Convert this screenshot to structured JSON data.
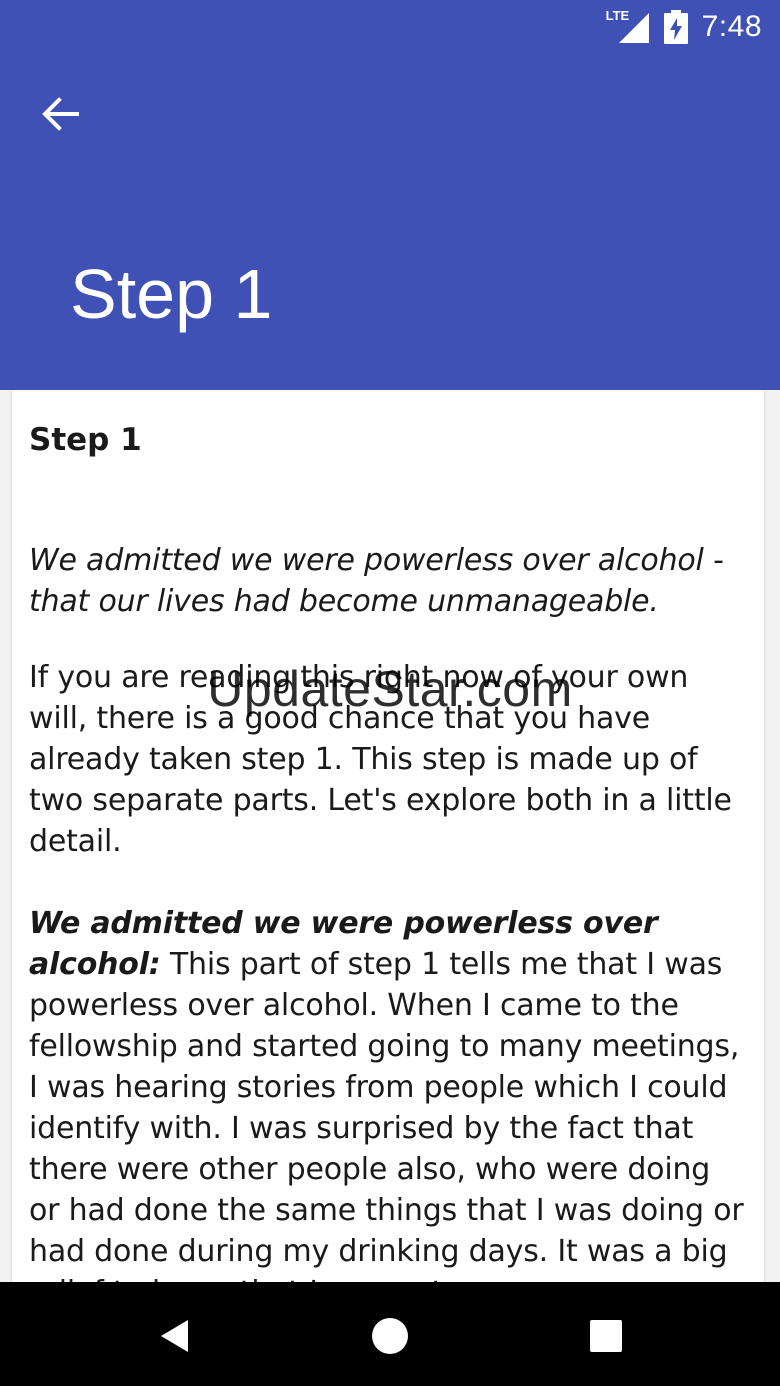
{
  "status_bar": {
    "network_label": "LTE",
    "time": "7:48",
    "icons": [
      "signal-icon",
      "battery-charging-icon"
    ]
  },
  "toolbar": {
    "back_icon": "arrow-back-icon",
    "title": "Step 1"
  },
  "content": {
    "heading": "Step 1",
    "tagline": "We admitted we were powerless over alcohol - that our lives had become unmanageable.",
    "paragraph1": "If you are reading this right now of your own will, there is a good chance that you have already taken step 1. This step is made up of two separate parts. Let's explore both in a little detail.",
    "section_title": "We admitted we were powerless over alcohol:",
    "paragraph2": " This part of step 1 tells me that I was powerless over alcohol. When I came to the fellowship and started going to many meetings, I was hearing stories from people which I could identify with. I was surprised by the fact that there were other people also, who were doing or had done the same things that I was doing or had done during my drinking days. It was a big relief to know that I was not"
  },
  "watermark": "UpdateStar.com",
  "nav_bar": {
    "icons": [
      "nav-back-icon",
      "nav-home-icon",
      "nav-recents-icon"
    ]
  },
  "colors": {
    "primary": "#3f51b5",
    "background": "#f2f2f2",
    "card": "#ffffff",
    "text": "#1a1a1a",
    "nav_bar": "#000000"
  }
}
